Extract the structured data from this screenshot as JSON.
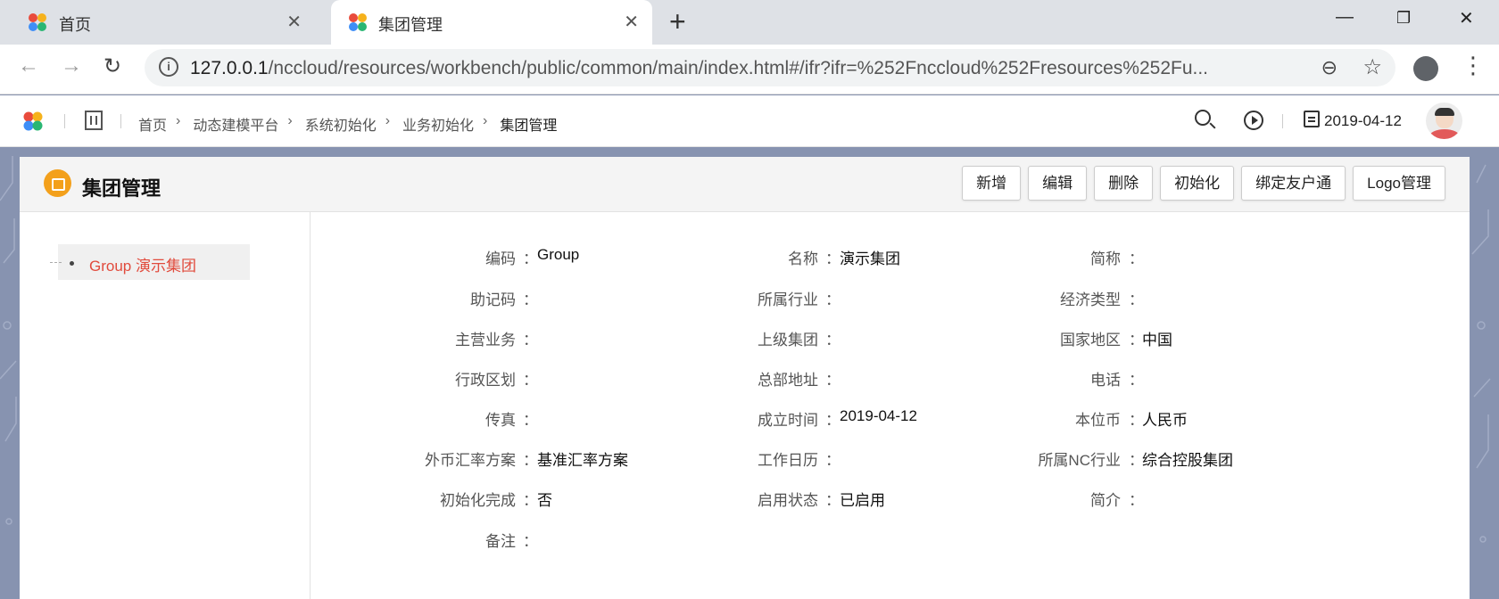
{
  "browser": {
    "tabs": [
      {
        "label": "首页"
      },
      {
        "label": "集团管理"
      }
    ],
    "url_host": "127.0.0.1",
    "url_path": "/nccloud/resources/workbench/public/common/main/index.html#/ifr?ifr=%252Fnccloud%252Fresources%252Fu..."
  },
  "header": {
    "breadcrumbs": [
      "首页",
      "动态建模平台",
      "系统初始化",
      "业务初始化",
      "集团管理"
    ],
    "date": "2019-04-12"
  },
  "page": {
    "title": "集团管理",
    "buttons": [
      "新增",
      "编辑",
      "删除",
      "初始化",
      "绑定友户通",
      "Logo管理"
    ]
  },
  "tree": {
    "node_label": "Group 演示集团"
  },
  "form": {
    "rows": [
      [
        {
          "label": "编码",
          "value": "Group"
        },
        {
          "label": "名称",
          "value": "演示集团"
        },
        {
          "label": "简称",
          "value": ""
        }
      ],
      [
        {
          "label": "助记码",
          "value": ""
        },
        {
          "label": "所属行业",
          "value": ""
        },
        {
          "label": "经济类型",
          "value": ""
        }
      ],
      [
        {
          "label": "主营业务",
          "value": ""
        },
        {
          "label": "上级集团",
          "value": ""
        },
        {
          "label": "国家地区",
          "value": "中国"
        }
      ],
      [
        {
          "label": "行政区划",
          "value": ""
        },
        {
          "label": "总部地址",
          "value": ""
        },
        {
          "label": "电话",
          "value": ""
        }
      ],
      [
        {
          "label": "传真",
          "value": ""
        },
        {
          "label": "成立时间",
          "value": "2019-04-12"
        },
        {
          "label": "本位币",
          "value": "人民币"
        }
      ],
      [
        {
          "label": "外币汇率方案",
          "value": "基准汇率方案"
        },
        {
          "label": "工作日历",
          "value": ""
        },
        {
          "label": "所属NC行业",
          "value": "综合控股集团"
        }
      ],
      [
        {
          "label": "初始化完成",
          "value": "否"
        },
        {
          "label": "启用状态",
          "value": "已启用"
        },
        {
          "label": "简介",
          "value": ""
        }
      ],
      [
        {
          "label": "备注",
          "value": ""
        }
      ]
    ],
    "colon": "："
  },
  "colors": {
    "accent_red": "#e14b3d",
    "title_icon": "#f3a01b",
    "backdrop": "#8793b0"
  }
}
